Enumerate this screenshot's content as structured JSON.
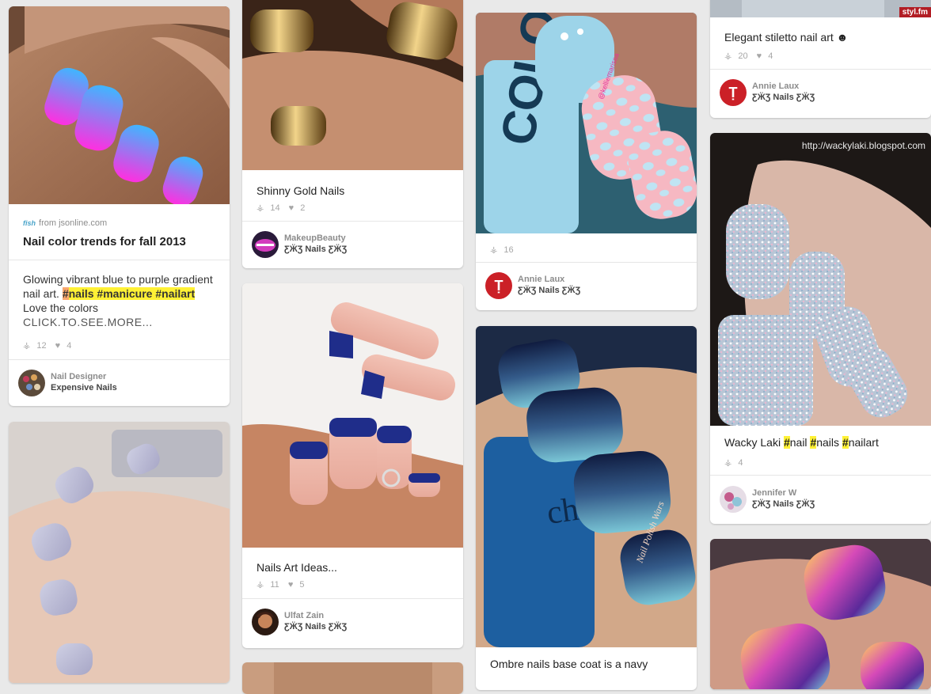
{
  "pins": [
    {
      "source_icon": "fish",
      "source": "from jsonline.com",
      "title": "Nail color trends for fall 2013",
      "desc_parts": [
        "Glowing vibrant blue to purple gradient nail art. ",
        "#",
        "nails ",
        "#",
        "manicure ",
        "#",
        "nailart",
        " Love the colors "
      ],
      "more": "CLICK.TO.SEE.MORE...",
      "repins": "12",
      "likes": "4",
      "pinner": "Nail Designer",
      "board": "Expensive Nails"
    },
    {
      "title": "Shinny Gold Nails",
      "repins": "14",
      "likes": "2",
      "pinner": "MakeupBeauty",
      "board": "ƸӜƷ Nails ƸӜƷ"
    },
    {
      "title": "Nails Art Ideas...",
      "repins": "11",
      "likes": "5",
      "pinner": "Ulfat Zain",
      "board": "ƸӜƷ Nails ƸӜƷ"
    },
    {
      "repins": "16",
      "pinner": "Annie Laux",
      "board": "ƸӜƷ Nails ƸӜƷ",
      "watermark": "@kelliemarissa"
    },
    {
      "title": "Ombre nails base coat is a navy",
      "watermark": "Nail Polish Wars"
    },
    {
      "title": "Elegant stiletto nail art",
      "title_icon": "☻",
      "repins": "20",
      "likes": "4",
      "pinner": "Annie Laux",
      "board": "ƸӜƷ Nails ƸӜƷ",
      "badge": "styl.fm"
    },
    {
      "title_parts": [
        "Wacky Laki ",
        "#",
        "nail ",
        "#",
        "nails ",
        "#",
        "nailart"
      ],
      "repins": "4",
      "pinner": "Jennifer W",
      "board": "ƸӜƷ Nails ƸӜƷ",
      "watermark": "http://wackylaki.blogspot.com"
    }
  ],
  "icons": {
    "repin": "repin-icon",
    "like": "heart-icon",
    "pin": "pin-icon"
  },
  "colors": {
    "hashtag": "#fff135",
    "pin_red": "#cb2027",
    "bg": "#e9e9e9"
  }
}
